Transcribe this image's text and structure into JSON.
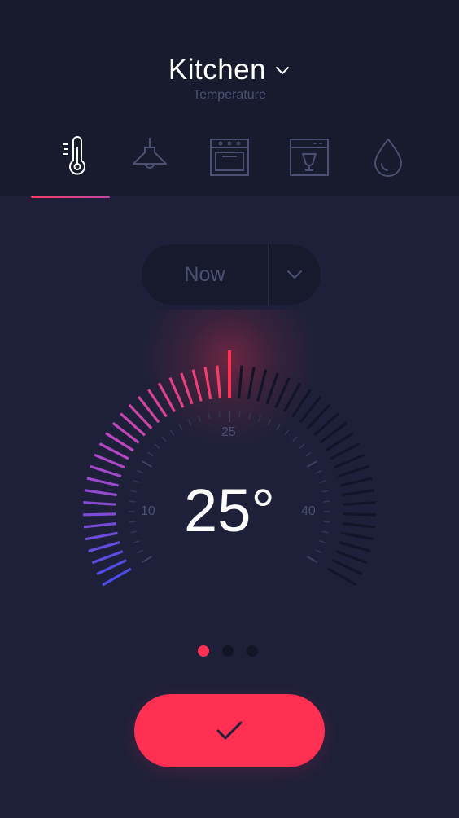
{
  "header": {
    "room": "Kitchen",
    "subtitle": "Temperature"
  },
  "tabs": [
    {
      "icon": "thermometer-icon",
      "active": true
    },
    {
      "icon": "lamp-icon",
      "active": false
    },
    {
      "icon": "oven-icon",
      "active": false
    },
    {
      "icon": "dishwasher-icon",
      "active": false
    },
    {
      "icon": "water-drop-icon",
      "active": false
    }
  ],
  "period": {
    "selected": "Now"
  },
  "thermostat": {
    "value": 25,
    "display": "25°",
    "min": 0,
    "max": 50,
    "scale_labels": {
      "low": "10",
      "mid": "25",
      "high": "40"
    }
  },
  "pagination": {
    "count": 3,
    "active": 0
  },
  "colors": {
    "accent": "#ff3052",
    "gradient_start": "#4a4ee6",
    "gradient_mid": "#b947c4",
    "gradient_end": "#ff3b5f",
    "inactive_tick": "#121427",
    "background": "#1e2039",
    "header_background": "#181a2e"
  }
}
